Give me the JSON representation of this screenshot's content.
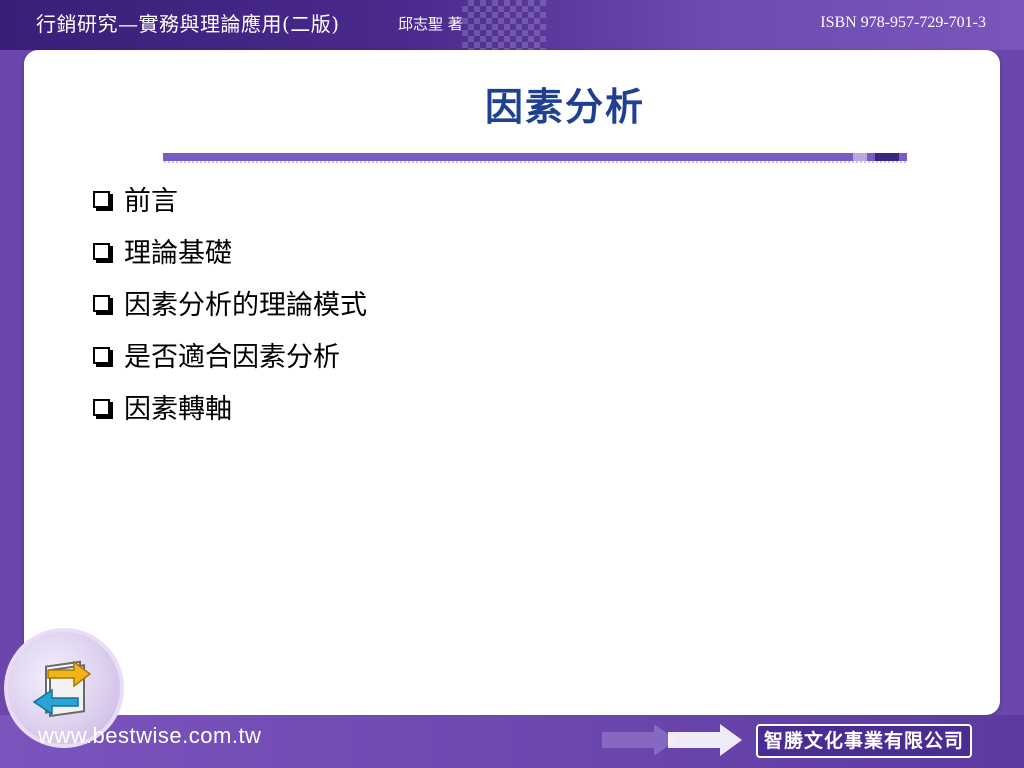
{
  "header": {
    "book_title": "行銷研究—實務與理論應用(二版)",
    "author": "邱志聖  著",
    "isbn": "ISBN 978-957-729-701-3"
  },
  "slide": {
    "title": "因素分析",
    "bullets": [
      "前言",
      "理論基礎",
      "因素分析的理論模式",
      "是否適合因素分析",
      "因素轉軸"
    ]
  },
  "footer": {
    "url": "www.bestwise.com.tw",
    "publisher": "智勝文化事業有限公司"
  },
  "colors": {
    "brand_purple": "#6b46ad",
    "dark_purple": "#3a1e78",
    "title_blue": "#1f3f8f"
  },
  "icons": [
    "checkbox-bullet-icon",
    "logo-arrows-icon",
    "double-arrow-icon"
  ]
}
